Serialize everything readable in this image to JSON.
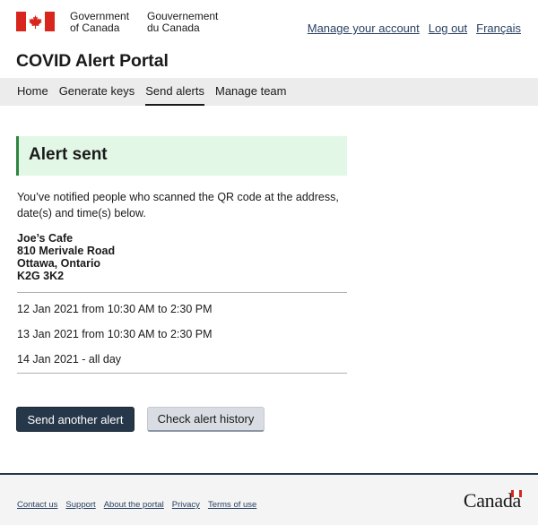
{
  "header": {
    "gov_en_line1": "Government",
    "gov_en_line2": "of Canada",
    "gov_fr_line1": "Gouvernement",
    "gov_fr_line2": "du Canada",
    "links": {
      "manage_account": "Manage your account",
      "logout": "Log out",
      "language": "Français"
    },
    "portal_title": "COVID Alert Portal"
  },
  "nav": {
    "items": [
      {
        "label": "Home"
      },
      {
        "label": "Generate keys"
      },
      {
        "label": "Send alerts"
      },
      {
        "label": "Manage team"
      }
    ],
    "active": "Send alerts"
  },
  "main": {
    "alert_title": "Alert sent",
    "intro": "You’ve notified people who scanned the QR code at the address, date(s) and time(s) below.",
    "address": {
      "name": "Joe’s Cafe",
      "street": "810 Merivale Road",
      "city": "Ottawa, Ontario",
      "postal": "K2G 3K2"
    },
    "dates": [
      "12 Jan 2021 from 10:30 AM to 2:30 PM",
      "13 Jan 2021 from 10:30 AM to 2:30 PM",
      "14 Jan 2021 - all day"
    ],
    "buttons": {
      "send_another": "Send another alert",
      "check_history": "Check alert history"
    }
  },
  "footer": {
    "links": [
      "Contact us",
      "Support",
      "About the portal",
      "Privacy",
      "Terms of use"
    ],
    "wordmark": "Canada"
  },
  "colors": {
    "accent_dark": "#26374a",
    "success_border": "#2e8540",
    "success_bg": "#e2f7e6",
    "flag_red": "#d8261e",
    "link": "#284162"
  }
}
